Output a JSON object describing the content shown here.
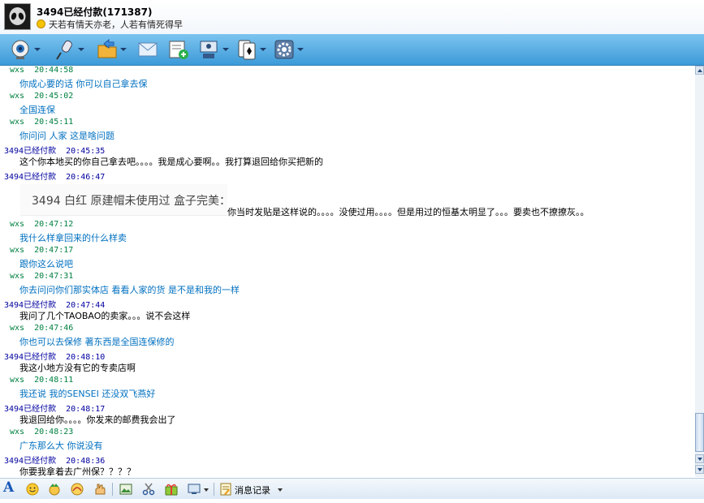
{
  "header": {
    "contact_name": "3494已经付款(171387)",
    "signature": "天若有情天亦老，人若有情死得早"
  },
  "toolbar": {
    "buttons": [
      "video-call",
      "voice-call",
      "send-file",
      "send-message",
      "add-contact",
      "remote-assistance",
      "game",
      "settings"
    ]
  },
  "chat": {
    "messages": [
      {
        "sender": "wxs",
        "time": "20:44:58",
        "text": "你成心要的话 你可以自己拿去保"
      },
      {
        "sender": "wxs",
        "time": "20:45:02",
        "text": "全国连保"
      },
      {
        "sender": "wxs",
        "time": "20:45:11",
        "text": "你问问 人家 这是啥问题"
      },
      {
        "sender": "3494已经付款",
        "time": "20:45:35",
        "text": "这个你本地买的你自己拿去吧。。。。我是成心要啊。。我打算退回给你买把新的"
      },
      {
        "sender": "3494已经付款",
        "time": "20:46:47",
        "photo_caption": "3494 白红 原建帽未使用过 盒子完美：",
        "text": "你当时发贴是这样说的。。。。没使过用。。。。但是用过的恒基太明显了。。。要卖也不撩撩灰。。"
      },
      {
        "sender": "wxs",
        "time": "20:47:12",
        "text": "我什么样拿回来的什么样卖"
      },
      {
        "sender": "wxs",
        "time": "20:47:17",
        "text": "跟你这么说吧"
      },
      {
        "sender": "wxs",
        "time": "20:47:31",
        "text": "你去问问你们那实体店 看看人家的货 是不是和我的一样"
      },
      {
        "sender": "3494已经付款",
        "time": "20:47:44",
        "text": "我问了几个TAOBAO的卖家。。。说不会这样"
      },
      {
        "sender": "wxs",
        "time": "20:47:46",
        "text": "你也可以去保修 著东西是全国连保修的"
      },
      {
        "sender": "3494已经付款",
        "time": "20:48:10",
        "text": "我这小地方没有它的专卖店啊"
      },
      {
        "sender": "wxs",
        "time": "20:48:11",
        "text": "我还说 我的SENSEI 还没双飞燕好"
      },
      {
        "sender": "3494已经付款",
        "time": "20:48:17",
        "text": "我退回给你。。。。你发来的邮费我会出了"
      },
      {
        "sender": "wxs",
        "time": "20:48:23",
        "text": "广东那么大 你说没有"
      },
      {
        "sender": "3494已经付款",
        "time": "20:48:36",
        "text": "你要我拿着去广州保？？？？"
      }
    ]
  },
  "bottom_bar": {
    "font_label": "A",
    "history_label": "消息记录"
  },
  "colors": {
    "toolbar_bg": "#3c9ad8",
    "other_name": "#008040",
    "self_name": "#0000a0",
    "other_text": "#0070c0",
    "self_text": "#000000"
  }
}
